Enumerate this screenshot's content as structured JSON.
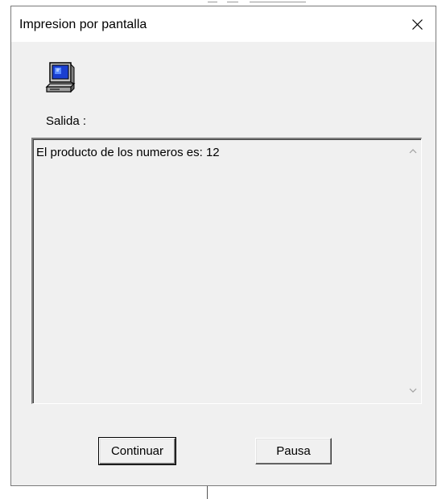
{
  "window": {
    "title": "Impresion por pantalla",
    "close_icon": "close-icon"
  },
  "icon": "computer-icon",
  "output": {
    "label": "Salida :",
    "text": "El producto de los numeros es: 12"
  },
  "buttons": {
    "continue_label": "Continuar",
    "pause_label": "Pausa"
  },
  "colors": {
    "dialog_bg": "#f0f0f0",
    "titlebar_bg": "#ffffff",
    "icon_blue": "#1a3fd0"
  }
}
